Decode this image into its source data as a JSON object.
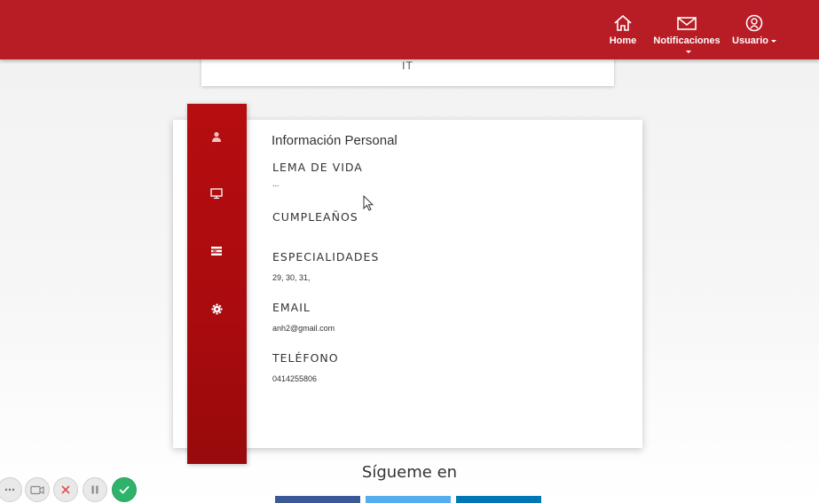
{
  "nav": {
    "home_label": "Home",
    "notifications_label": "Notificaciones",
    "user_label": "Usuario"
  },
  "top_card": {
    "text": "IT"
  },
  "profile": {
    "title": "Información Personal",
    "fields": [
      {
        "label": "LEMA DE VIDA",
        "value": "..."
      },
      {
        "label": "CUMPLEAÑOS",
        "value": ""
      },
      {
        "label": "ESPECIALIDADES",
        "value": "29, 30, 31,"
      },
      {
        "label": "EMAIL",
        "value": "anh2@gmail.com"
      },
      {
        "label": "TELÉFONO",
        "value": "0414255806"
      }
    ]
  },
  "side_rail": {
    "icons": [
      "user-icon",
      "monitor-icon",
      "list-icon",
      "gear-icon"
    ]
  },
  "footer": {
    "follow_title": "Sígueme en"
  },
  "colors": {
    "topbar": "#b81c25",
    "rail": "#b60d10",
    "facebook": "#3b5998",
    "twitter": "#55acee",
    "linkedin": "#0077b5",
    "recorder_done": "#2fb36a"
  }
}
